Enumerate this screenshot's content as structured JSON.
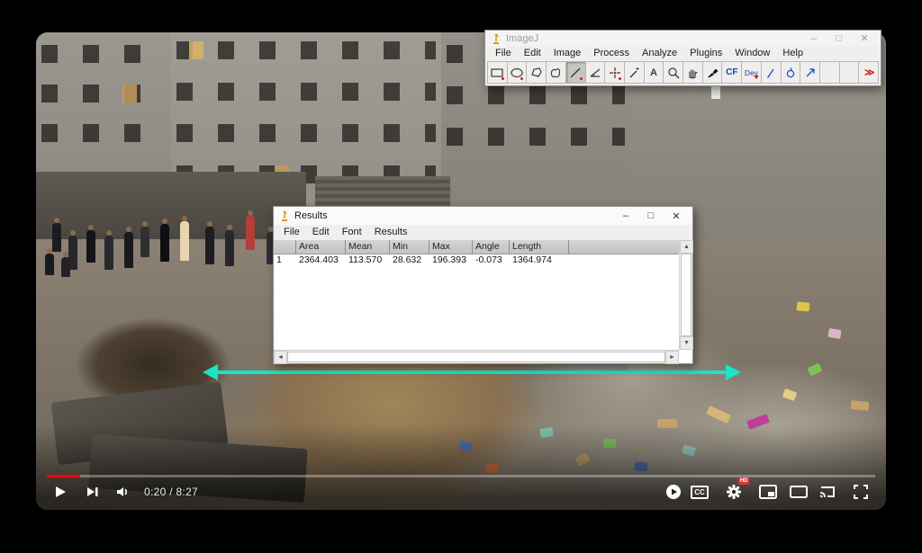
{
  "player": {
    "time_display": "0:20 / 8:27",
    "progress_percent": 4,
    "progress_color": "#ff0000",
    "cc_label": "CC",
    "hd_badge": "HD"
  },
  "measurement": {
    "line_color": "#1ae4c4"
  },
  "imagej": {
    "window_title": "ImageJ",
    "menu_items": [
      "File",
      "Edit",
      "Image",
      "Process",
      "Analyze",
      "Plugins",
      "Window",
      "Help"
    ],
    "toolbar": {
      "selected_tool": "line",
      "cf_label": "CF",
      "dev_label": "Dev",
      "text_tool_label": "A",
      "more_tools_label": "≫"
    }
  },
  "results": {
    "window_title": "Results",
    "menu_items": [
      "File",
      "Edit",
      "Font",
      "Results"
    ],
    "table": {
      "columns": [
        "",
        "Area",
        "Mean",
        "Min",
        "Max",
        "Angle",
        "Length"
      ],
      "rows": [
        [
          "1",
          "2364.403",
          "113.570",
          "28.632",
          "196.393",
          "-0.073",
          "1364.974"
        ]
      ]
    }
  },
  "ui_icons": {
    "minimize": "–",
    "maximize": "□",
    "close": "✕",
    "scroll_up": "▲",
    "scroll_down": "▼",
    "scroll_left": "◄",
    "scroll_right": "►"
  }
}
